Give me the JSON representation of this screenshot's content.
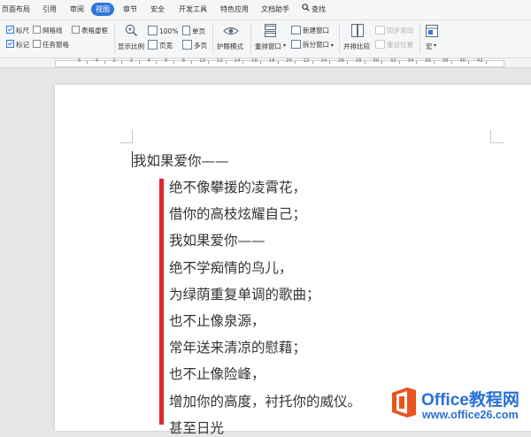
{
  "menu": {
    "tabs": [
      "页面布局",
      "引用",
      "审阅",
      "视图",
      "章节",
      "安全",
      "开发工具",
      "特色应用",
      "文档助手",
      "查找"
    ],
    "active_tab": "视图"
  },
  "ribbon": {
    "show": {
      "ruler": {
        "label": "标尺",
        "checked": true
      },
      "gridlines": {
        "label": "网格线",
        "checked": false
      },
      "table_gridlines": {
        "label": "表格虚框",
        "checked": false
      },
      "marks": {
        "label": "标记",
        "checked": true
      },
      "task_pane": {
        "label": "任务窗格",
        "checked": false
      }
    },
    "zoom_label": "显示比例",
    "zoom_100": "100%",
    "page_width": "页宽",
    "single_page": "单页",
    "multi_page": "多页",
    "eye_mode": "护眼模式",
    "arrange_windows": "重排窗口",
    "new_window": "新建窗口",
    "split_window": "拆分窗口",
    "side_by_side": "并排比较",
    "sync_scroll": "同步滚动",
    "reset_position": "重设位置",
    "macro": "宏"
  },
  "ruler": {
    "labels": [
      "6",
      "4",
      "2",
      "2",
      "4",
      "6",
      "8",
      "10",
      "12",
      "14",
      "16",
      "18",
      "20",
      "22",
      "24",
      "26",
      "28",
      "30",
      "32",
      "34",
      "36",
      "38",
      "40",
      "42"
    ]
  },
  "document": {
    "first_line": "我如果爱你——",
    "lines": [
      "绝不像攀援的凌霄花，",
      "借你的高枝炫耀自己；",
      "我如果爱你——",
      "绝不学痴情的鸟儿，",
      "为绿荫重复单调的歌曲；",
      "也不止像泉源，",
      "常年送来清凉的慰藉；",
      "也不止像险峰，",
      "增加你的高度，衬托你的威仪。",
      "甚至日光"
    ],
    "bar_color": "#e0282c"
  },
  "watermark": {
    "title": "Office教程网",
    "url": "www.office26.com",
    "color": "#2a6fd6",
    "logo_color": "#e8541e"
  }
}
